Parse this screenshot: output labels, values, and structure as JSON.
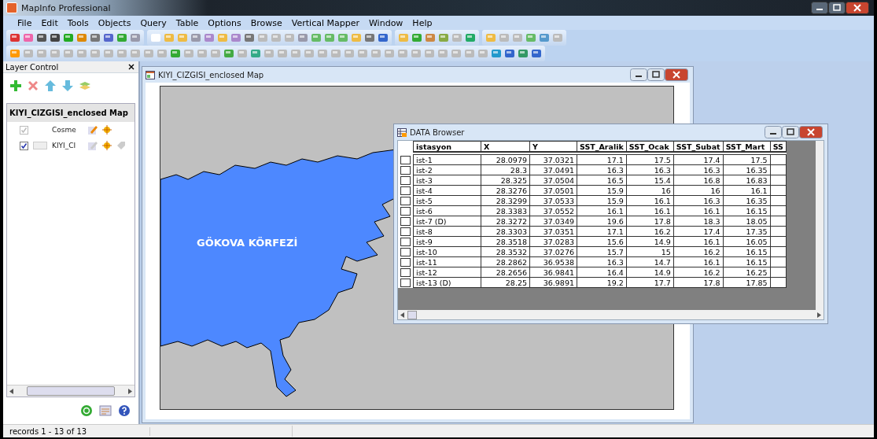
{
  "window": {
    "title": "MapInfo Professional"
  },
  "menu": [
    "File",
    "Edit",
    "Tools",
    "Objects",
    "Query",
    "Table",
    "Options",
    "Browse",
    "Vertical Mapper",
    "Window",
    "Help"
  ],
  "layer_control": {
    "title": "Layer Control",
    "map_title": "KIYI_CIZGISI_enclosed Map",
    "layers": [
      {
        "name": "Cosme",
        "checked": true,
        "disabled": true,
        "kind": "cosmetic"
      },
      {
        "name": "KIYI_CI",
        "checked": true,
        "disabled": false,
        "kind": "region"
      }
    ]
  },
  "map_window": {
    "title": "KIYI_CIZGISI_enclosed Map",
    "label": "GÖKOVA KÖRFEZİ"
  },
  "browser": {
    "title": "DATA Browser",
    "columns": [
      "istasyon",
      "X",
      "Y",
      "SST_Aralik",
      "SST_Ocak",
      "SST_Subat",
      "SST_Mart",
      "SS"
    ],
    "rows": [
      {
        "selected": false,
        "cells": [
          "ist-1",
          "28.0979",
          "37.0321",
          "17.1",
          "17.5",
          "17.4",
          "17.5"
        ]
      },
      {
        "selected": false,
        "cells": [
          "ist-2",
          "28.3",
          "37.0491",
          "16.3",
          "16.3",
          "16.3",
          "16.35"
        ]
      },
      {
        "selected": false,
        "cells": [
          "ist-3",
          "28.325",
          "37.0504",
          "16.5",
          "15.4",
          "16.8",
          "16.83"
        ]
      },
      {
        "selected": false,
        "cells": [
          "ist-4",
          "28.3276",
          "37.0501",
          "15.9",
          "16",
          "16",
          "16.1"
        ]
      },
      {
        "selected": false,
        "cells": [
          "ist-5",
          "28.3299",
          "37.0533",
          "15.9",
          "16.1",
          "16.3",
          "16.35"
        ]
      },
      {
        "selected": false,
        "cells": [
          "ist-6",
          "28.3383",
          "37.0552",
          "16.1",
          "16.1",
          "16.1",
          "16.15"
        ]
      },
      {
        "selected": false,
        "cells": [
          "ist-7 (D)",
          "28.3272",
          "37.0349",
          "19.6",
          "17.8",
          "18.3",
          "18.05"
        ]
      },
      {
        "selected": false,
        "cells": [
          "ist-8",
          "28.3303",
          "37.0351",
          "17.1",
          "16.2",
          "17.4",
          "17.35"
        ]
      },
      {
        "selected": false,
        "cells": [
          "ist-9",
          "28.3518",
          "37.0283",
          "15.6",
          "14.9",
          "16.1",
          "16.05"
        ]
      },
      {
        "selected": false,
        "cells": [
          "ist-10",
          "28.3532",
          "37.0276",
          "15.7",
          "15",
          "16.2",
          "16.15"
        ]
      },
      {
        "selected": false,
        "cells": [
          "ist-11",
          "28.2862",
          "36.9538",
          "16.3",
          "14.7",
          "16.1",
          "16.15"
        ]
      },
      {
        "selected": false,
        "cells": [
          "ist-12",
          "28.2656",
          "36.9841",
          "16.4",
          "14.9",
          "16.2",
          "16.25"
        ]
      },
      {
        "selected": false,
        "cells": [
          "ist-13 (D)",
          "28.25",
          "36.9891",
          "19.2",
          "17.7",
          "17.8",
          "17.85"
        ]
      }
    ]
  },
  "status_bar": {
    "text": "records 1 - 13 of 13"
  }
}
